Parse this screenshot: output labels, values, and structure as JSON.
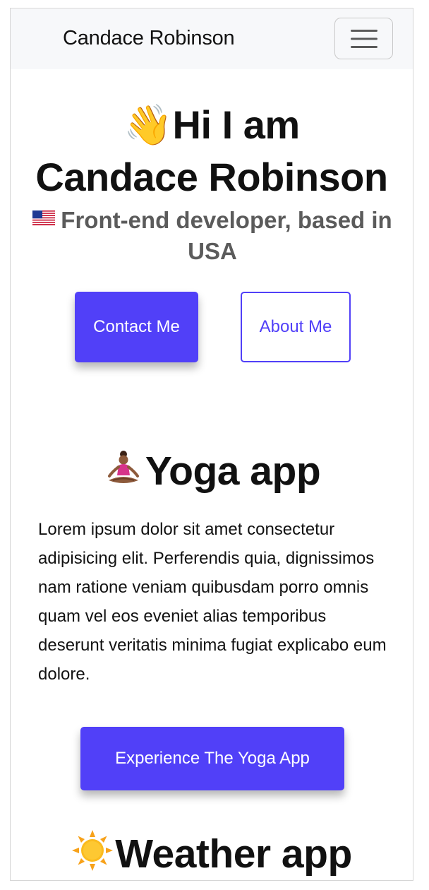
{
  "navbar": {
    "brand": "Candace Robinson",
    "toggler_icon": "hamburger-menu-icon"
  },
  "hero": {
    "wave_emoji": "👋",
    "title_line1": "Hi I am",
    "title_line2": "Candace Robinson",
    "flag_icon": "us-flag-icon",
    "subtitle": "Front-end developer, based in USA",
    "contact_label": "Contact Me",
    "about_label": "About Me"
  },
  "projects": [
    {
      "icon": "person-meditating-icon",
      "title": "Yoga app",
      "description": "Lorem ipsum dolor sit amet consectetur adipisicing elit. Perferendis quia, dignissimos nam ratione veniam quibusdam porro omnis quam vel eos eveniet alias temporibus deserunt veritatis minima fugiat explicabo eum dolore.",
      "button_label": "Experience The Yoga App"
    },
    {
      "icon": "sun-icon",
      "title": "Weather app"
    }
  ],
  "colors": {
    "accent": "#5140f8",
    "navbar_bg": "#f7f8fa",
    "subtitle": "#5b5b5b"
  }
}
